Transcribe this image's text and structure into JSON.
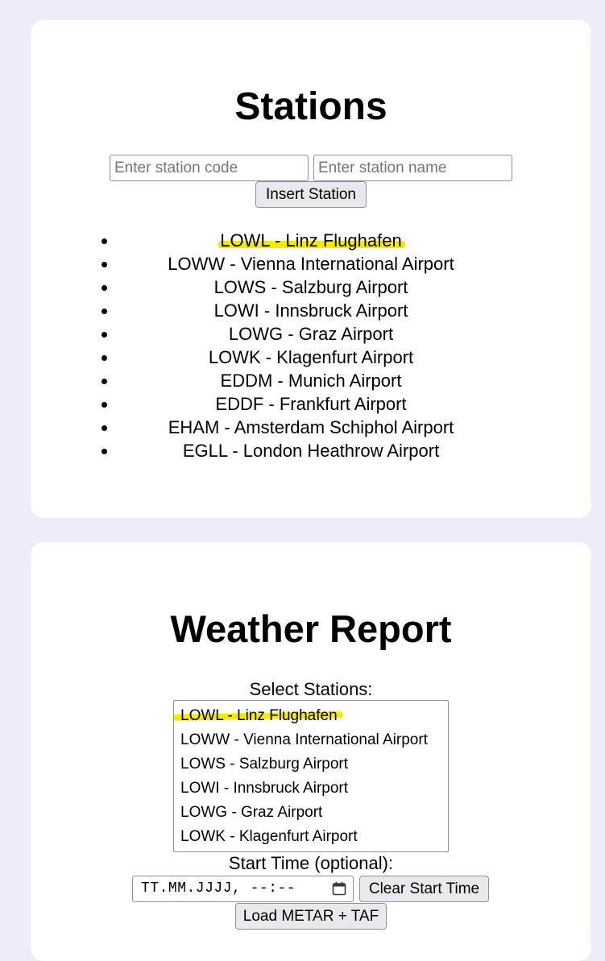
{
  "stations_section": {
    "title": "Stations",
    "code_placeholder": "Enter station code",
    "name_placeholder": "Enter station name",
    "insert_button_label": "Insert Station",
    "stations": [
      "LOWL - Linz Flughafen",
      "LOWW - Vienna International Airport",
      "LOWS - Salzburg Airport",
      "LOWI - Innsbruck Airport",
      "LOWG - Graz Airport",
      "LOWK - Klagenfurt Airport",
      "EDDM - Munich Airport",
      "EDDF - Frankfurt Airport",
      "EHAM - Amsterdam Schiphol Airport",
      "EGLL - London Heathrow Airport"
    ]
  },
  "weather_section": {
    "title": "Weather Report",
    "select_label": "Select Stations:",
    "select_options": [
      "LOWL - Linz Flughafen",
      "LOWW - Vienna International Airport",
      "LOWS - Salzburg Airport",
      "LOWI - Innsbruck Airport",
      "LOWG - Graz Airport",
      "LOWK - Klagenfurt Airport"
    ],
    "start_time_label": "Start Time (optional):",
    "datetime_placeholder": "TT.MM.JJJJ, --:--",
    "clear_button_label": "Clear Start Time",
    "load_button_label": "Load METAR + TAF"
  },
  "colors": {
    "page_background": "#ececfb",
    "card_background": "#ffffff",
    "highlight": "#f7ea00"
  },
  "icons": {
    "datetime_picker": "calendar-icon"
  }
}
